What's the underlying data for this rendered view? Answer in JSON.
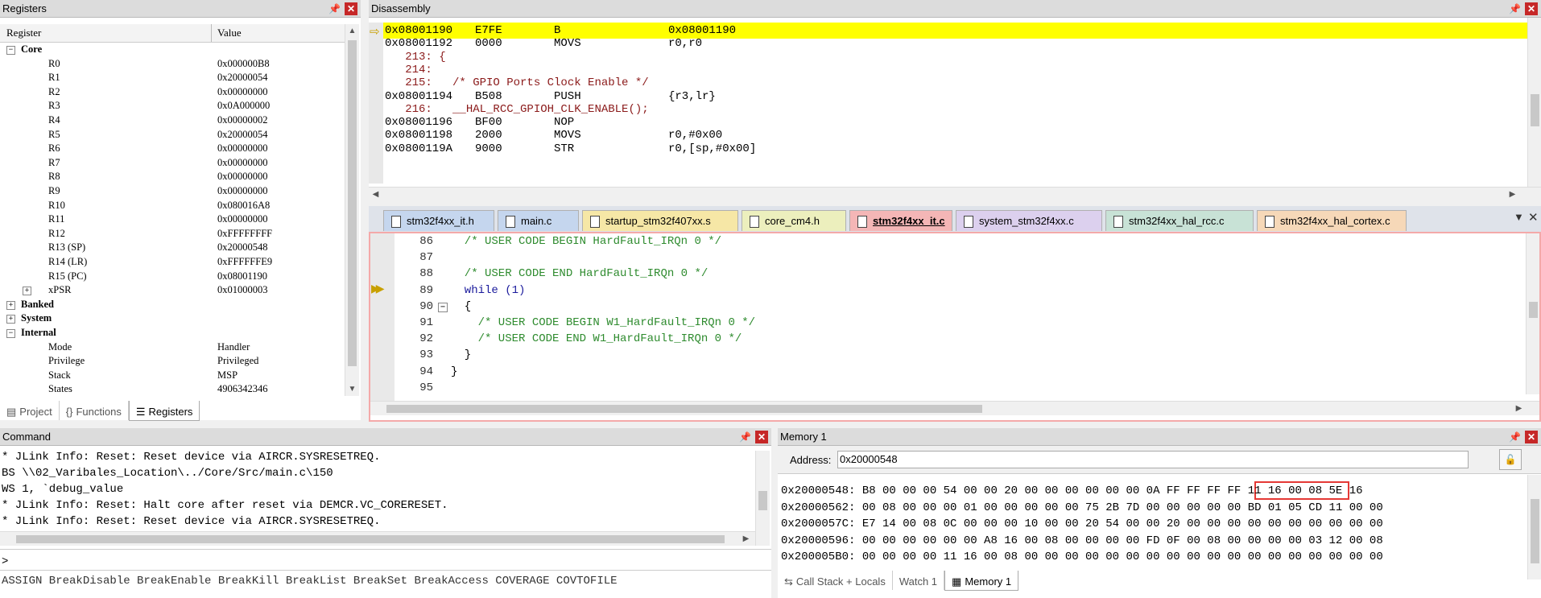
{
  "registers": {
    "title": "Registers",
    "col_register": "Register",
    "col_value": "Value",
    "groups": {
      "core": "Core",
      "banked": "Banked",
      "system": "System",
      "internal": "Internal"
    },
    "core_rows": [
      {
        "name": "R0",
        "value": "0x000000B8"
      },
      {
        "name": "R1",
        "value": "0x20000054"
      },
      {
        "name": "R2",
        "value": "0x00000000"
      },
      {
        "name": "R3",
        "value": "0x0A000000"
      },
      {
        "name": "R4",
        "value": "0x00000002"
      },
      {
        "name": "R5",
        "value": "0x20000054"
      },
      {
        "name": "R6",
        "value": "0x00000000"
      },
      {
        "name": "R7",
        "value": "0x00000000"
      },
      {
        "name": "R8",
        "value": "0x00000000"
      },
      {
        "name": "R9",
        "value": "0x00000000"
      },
      {
        "name": "R10",
        "value": "0x080016A8"
      },
      {
        "name": "R11",
        "value": "0x00000000"
      },
      {
        "name": "R12",
        "value": "0xFFFFFFFF"
      },
      {
        "name": "R13 (SP)",
        "value": "0x20000548"
      },
      {
        "name": "R14 (LR)",
        "value": "0xFFFFFFE9"
      },
      {
        "name": "R15 (PC)",
        "value": "0x08001190"
      },
      {
        "name": "xPSR",
        "value": "0x01000003"
      }
    ],
    "internal_rows": [
      {
        "name": "Mode",
        "value": "Handler"
      },
      {
        "name": "Privilege",
        "value": "Privileged"
      },
      {
        "name": "Stack",
        "value": "MSP"
      },
      {
        "name": "States",
        "value": "4906342346"
      }
    ]
  },
  "left_tabs": [
    "Project",
    "Functions",
    "Registers"
  ],
  "disassembly": {
    "title": "Disassembly",
    "lines": [
      {
        "addr": "0x08001190",
        "op": "E7FE",
        "mn": "B",
        "arg": "0x08001190"
      },
      {
        "addr": "0x08001192",
        "op": "0000",
        "mn": "MOVS",
        "arg": "r0,r0"
      },
      {
        "src": "   213: {"
      },
      {
        "src": "   214: "
      },
      {
        "src": "   215:   /* GPIO Ports Clock Enable */"
      },
      {
        "addr": "0x08001194",
        "op": "B508",
        "mn": "PUSH",
        "arg": "{r3,lr}"
      },
      {
        "src": "   216:   __HAL_RCC_GPIOH_CLK_ENABLE();"
      },
      {
        "addr": "0x08001196",
        "op": "BF00",
        "mn": "NOP",
        "arg": ""
      },
      {
        "addr": "0x08001198",
        "op": "2000",
        "mn": "MOVS",
        "arg": "r0,#0x00"
      },
      {
        "addr": "0x0800119A",
        "op": "9000",
        "mn": "STR",
        "arg": "r0,[sp,#0x00]"
      }
    ]
  },
  "editor_tabs": [
    "stm32f4xx_it.h",
    "main.c",
    "startup_stm32f407xx.s",
    "core_cm4.h",
    "stm32f4xx_it.c",
    "system_stm32f4xx.c",
    "stm32f4xx_hal_rcc.c",
    "stm32f4xx_hal_cortex.c"
  ],
  "code_lines": [
    {
      "n": "86",
      "t": "  /* USER CODE BEGIN HardFault_IRQn 0 */",
      "c": "cmt"
    },
    {
      "n": "87",
      "t": "",
      "c": ""
    },
    {
      "n": "88",
      "t": "  /* USER CODE END HardFault_IRQn 0 */",
      "c": "cmt"
    },
    {
      "n": "89",
      "t": "  while (1)",
      "c": "kw"
    },
    {
      "n": "90",
      "t": "  {",
      "c": ""
    },
    {
      "n": "91",
      "t": "    /* USER CODE BEGIN W1_HardFault_IRQn 0 */",
      "c": "cmt"
    },
    {
      "n": "92",
      "t": "    /* USER CODE END W1_HardFault_IRQn 0 */",
      "c": "cmt"
    },
    {
      "n": "93",
      "t": "  }",
      "c": ""
    },
    {
      "n": "94",
      "t": "}",
      "c": ""
    },
    {
      "n": "95",
      "t": "",
      "c": ""
    }
  ],
  "command": {
    "title": "Command",
    "lines": [
      "* JLink Info: Reset: Reset device via AIRCR.SYSRESETREQ.",
      "BS \\\\02_Varibales_Location\\../Core/Src/main.c\\150",
      "WS 1, `debug_value",
      "* JLink Info: Reset: Halt core after reset via DEMCR.VC_CORERESET.",
      "* JLink Info: Reset: Reset device via AIRCR.SYSRESETREQ."
    ],
    "prompt": ">",
    "hints": "ASSIGN BreakDisable BreakEnable BreakKill BreakList BreakSet BreakAccess COVERAGE COVTOFILE"
  },
  "memory": {
    "title": "Memory 1",
    "address_label": "Address:",
    "address_value": "0x20000548",
    "lines": [
      "0x20000548: B8 00 00 00 54 00 00 20 00 00 00 00 00 00 0A FF FF FF FF 11 16 00 08 5E 16",
      "0x20000562: 00 08 00 00 00 01 00 00 00 00 00 75 2B 7D 00 00 00 00 00 BD 01 05 CD 11 00 00",
      "0x2000057C: E7 14 00 08 0C 00 00 00 10 00 00 20 54 00 00 20 00 00 00 00 00 00 00 00 00 00",
      "0x20000596: 00 00 00 00 00 00 A8 16 00 08 00 00 00 00 FD 0F 00 08 00 00 00 00 03 12 00 08",
      "0x200005B0: 00 00 00 00 11 16 00 08 00 00 00 00 00 00 00 00 00 00 00 00 00 00 00 00 00 00"
    ]
  },
  "bottom_tabs": [
    "Call Stack + Locals",
    "Watch 1",
    "Memory 1"
  ],
  "colors": {
    "exec_highlight": "#ffff00",
    "highlight_box": "#e53935"
  }
}
